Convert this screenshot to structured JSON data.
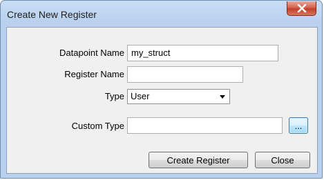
{
  "window": {
    "title": "Create New Register",
    "close_icon_glyph": "X"
  },
  "form": {
    "datapoint_name_label": "Datapoint Name",
    "datapoint_name_value": "my_struct",
    "register_name_label": "Register Name",
    "register_name_value": "",
    "type_label": "Type",
    "type_selected": "User",
    "custom_type_label": "Custom Type",
    "custom_type_value": "",
    "browse_label": "..."
  },
  "buttons": {
    "create_label": "Create Register",
    "close_label": "Close"
  },
  "icons": {
    "window_close": "close-icon",
    "dropdown": "chevron-down-icon"
  },
  "colors": {
    "titlebar": "#b9d1ee",
    "close_button": "#c2402a",
    "client_bg": "#f0f0f0",
    "browse_button_border": "#3c7fb1"
  }
}
